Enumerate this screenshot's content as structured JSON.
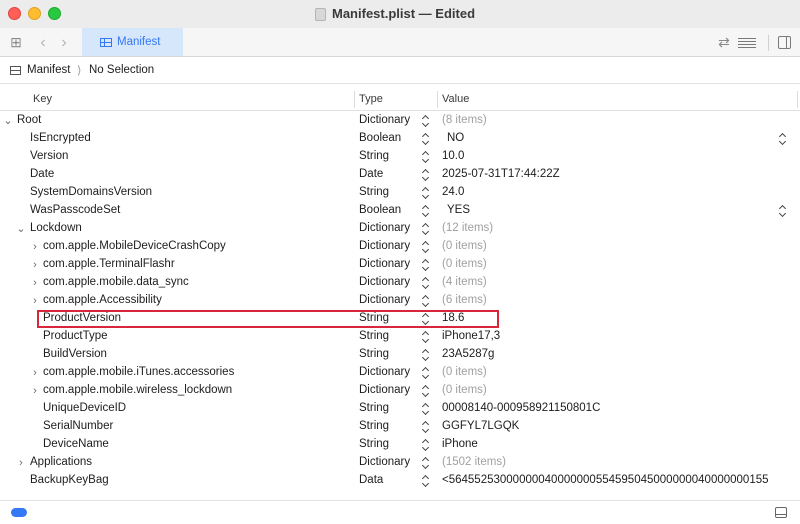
{
  "window": {
    "title": "Manifest.plist — Edited"
  },
  "tab": {
    "label": "Manifest"
  },
  "breadcrumb": {
    "file": "Manifest",
    "separator": "⟩",
    "selection": "No Selection"
  },
  "columns": {
    "key": "Key",
    "type": "Type",
    "value": "Value"
  },
  "rows": [
    {
      "key": "Root",
      "type": "Dictionary",
      "value": "(8 items)"
    },
    {
      "key": "IsEncrypted",
      "type": "Boolean",
      "value": "NO"
    },
    {
      "key": "Version",
      "type": "String",
      "value": "10.0"
    },
    {
      "key": "Date",
      "type": "Date",
      "value": "2025-07-31T17:44:22Z"
    },
    {
      "key": "SystemDomainsVersion",
      "type": "String",
      "value": "24.0"
    },
    {
      "key": "WasPasscodeSet",
      "type": "Boolean",
      "value": "YES"
    },
    {
      "key": "Lockdown",
      "type": "Dictionary",
      "value": "(12 items)"
    },
    {
      "key": "com.apple.MobileDeviceCrashCopy",
      "type": "Dictionary",
      "value": "(0 items)"
    },
    {
      "key": "com.apple.TerminalFlashr",
      "type": "Dictionary",
      "value": "(0 items)"
    },
    {
      "key": "com.apple.mobile.data_sync",
      "type": "Dictionary",
      "value": "(4 items)"
    },
    {
      "key": "com.apple.Accessibility",
      "type": "Dictionary",
      "value": "(6 items)"
    },
    {
      "key": "ProductVersion",
      "type": "String",
      "value": "18.6"
    },
    {
      "key": "ProductType",
      "type": "String",
      "value": "iPhone17,3"
    },
    {
      "key": "BuildVersion",
      "type": "String",
      "value": "23A5287g"
    },
    {
      "key": "com.apple.mobile.iTunes.accessories",
      "type": "Dictionary",
      "value": "(0 items)"
    },
    {
      "key": "com.apple.mobile.wireless_lockdown",
      "type": "Dictionary",
      "value": "(0 items)"
    },
    {
      "key": "UniqueDeviceID",
      "type": "String",
      "value": "00008140-000958921150801C"
    },
    {
      "key": "SerialNumber",
      "type": "String",
      "value": "GGFYL7LGQK"
    },
    {
      "key": "DeviceName",
      "type": "String",
      "value": "iPhone"
    },
    {
      "key": "Applications",
      "type": "Dictionary",
      "value": "(1502 items)"
    },
    {
      "key": "BackupKeyBag",
      "type": "Data",
      "value": "<56455253000000040000000554595045000000040000000155"
    }
  ],
  "colors": {
    "accent": "#3478f6",
    "highlight": "#d9263a"
  }
}
